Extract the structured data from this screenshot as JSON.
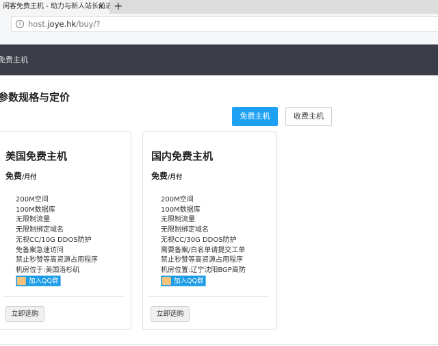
{
  "browser": {
    "tab_title": "闲客免费主机 - 助力与新人站长前进",
    "url_host_pre": "host.",
    "url_domain": "joye.hk",
    "url_path": "/buy/?"
  },
  "nav": {
    "brand": "免费主机"
  },
  "page": {
    "title": "参数规格与定价",
    "tabs": [
      {
        "label": "免费主机",
        "active": true
      },
      {
        "label": "收费主机",
        "active": false
      }
    ]
  },
  "accent": "#1ea1f3",
  "cards": [
    {
      "title": "美国免费主机",
      "price": "免费",
      "period": "/月付",
      "features": [
        "200M空间",
        "100M数据库",
        "无限制流量",
        "无限制绑定域名",
        "无视CC/10G DDOS防护",
        "免备案急速访问",
        "禁止秒赞等高资源占用程序",
        "机房位于:美国洛杉矶"
      ],
      "qq": "加入QQ群",
      "buy": "立即选购"
    },
    {
      "title": "国内免费主机",
      "price": "免费",
      "period": "/月付",
      "features": [
        "200M空间",
        "100M数据库",
        "无限制流量",
        "无限制绑定域名",
        "无视CC/30G DDOS防护",
        "需要备案/白名单请提交工单",
        "禁止秒赞等高资源占用程序",
        "机房位置:辽宁沈阳BGP高防"
      ],
      "qq": "加入QQ群",
      "buy": "立即选购"
    }
  ]
}
